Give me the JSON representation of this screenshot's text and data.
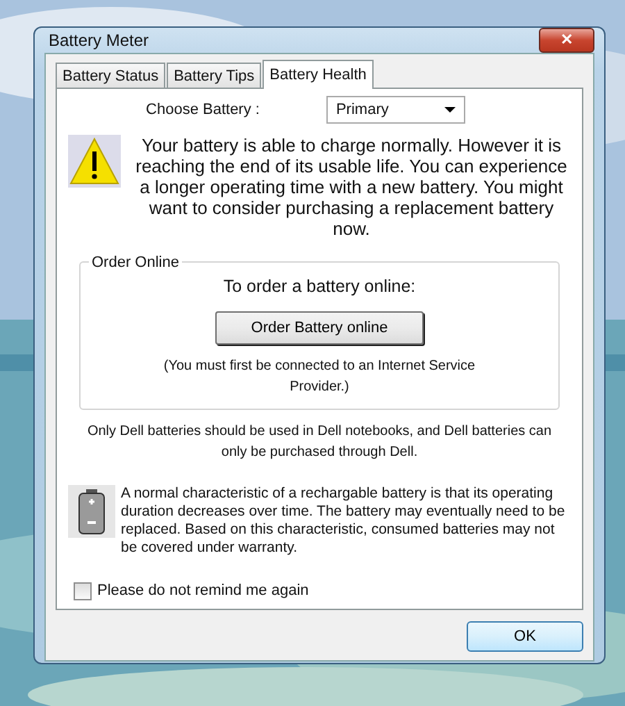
{
  "window": {
    "title": "Battery Meter",
    "close": "✕"
  },
  "tabs": [
    {
      "label": "Battery Status",
      "selected": false
    },
    {
      "label": "Battery Tips",
      "selected": false
    },
    {
      "label": "Battery Health",
      "selected": true
    }
  ],
  "choose_battery": {
    "label": "Choose Battery :",
    "value": "Primary"
  },
  "warning": "Your battery is able to charge normally. However it is reaching the end of its usable life. You can experience a longer operating time with a new battery. You might want to consider purchasing a replacement battery now.",
  "order_online": {
    "legend": "Order Online",
    "heading": "To order a battery online:",
    "button": "Order Battery online",
    "note": "(You must first be connected to an Internet Service Provider.)"
  },
  "dell_note": "Only Dell batteries should be used in Dell notebooks, and Dell batteries can only be purchased through Dell.",
  "battery_info": "A normal characteristic of a rechargable battery is that its operating duration decreases over time.  The battery may eventually need to be replaced.  Based on this characteristic, consumed batteries may not be covered under warranty.",
  "remind": {
    "label": "Please do not remind me again",
    "checked": false
  },
  "buttons": [
    "OK"
  ]
}
